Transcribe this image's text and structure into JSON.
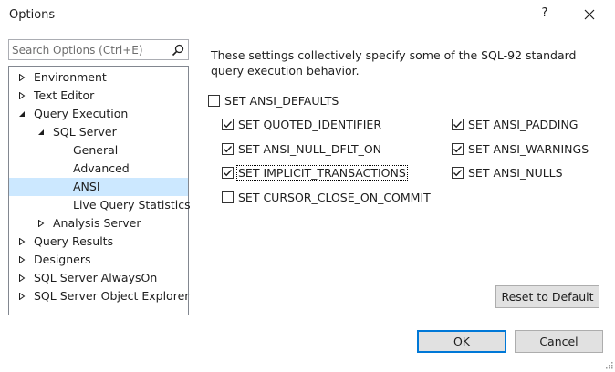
{
  "window": {
    "title": "Options",
    "help_label": "?"
  },
  "search": {
    "placeholder": "Search Options (Ctrl+E)",
    "value": ""
  },
  "tree": {
    "items": [
      {
        "label": "Environment",
        "expanded": false
      },
      {
        "label": "Text Editor",
        "expanded": false
      },
      {
        "label": "Query Execution",
        "expanded": true
      },
      {
        "label": "SQL Server",
        "expanded": true
      },
      {
        "label": "General"
      },
      {
        "label": "Advanced"
      },
      {
        "label": "ANSI",
        "selected": true
      },
      {
        "label": "Live Query Statistics"
      },
      {
        "label": "Analysis Server",
        "expanded": false
      },
      {
        "label": "Query Results",
        "expanded": false
      },
      {
        "label": "Designers",
        "expanded": false
      },
      {
        "label": "SQL Server AlwaysOn",
        "expanded": false
      },
      {
        "label": "SQL Server Object Explorer",
        "expanded": false
      }
    ]
  },
  "panel": {
    "description": "These settings collectively specify some of the SQL-92 standard query execution behavior.",
    "checkboxes": [
      {
        "label": "SET ANSI_DEFAULTS",
        "checked": false
      },
      {
        "label": "SET QUOTED_IDENTIFIER",
        "checked": true
      },
      {
        "label": "SET ANSI_NULL_DFLT_ON",
        "checked": true
      },
      {
        "label": "SET IMPLICIT_TRANSACTIONS",
        "checked": true,
        "focused": true
      },
      {
        "label": "SET CURSOR_CLOSE_ON_COMMIT",
        "checked": false
      },
      {
        "label": "SET ANSI_PADDING",
        "checked": true
      },
      {
        "label": "SET ANSI_WARNINGS",
        "checked": true
      },
      {
        "label": "SET ANSI_NULLS",
        "checked": true
      }
    ],
    "reset_label": "Reset to Default"
  },
  "footer": {
    "ok_label": "OK",
    "cancel_label": "Cancel"
  },
  "colors": {
    "selection": "#cce8ff",
    "default_button_border": "#0078d7",
    "button_face": "#e1e1e1"
  }
}
